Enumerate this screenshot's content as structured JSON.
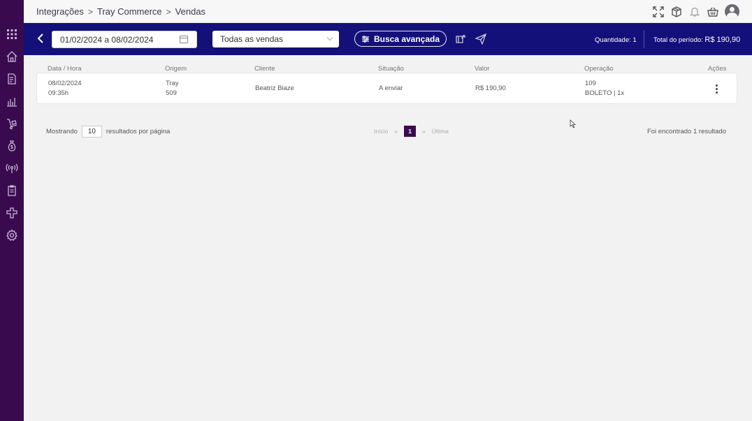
{
  "breadcrumb": {
    "items": [
      "Integrações",
      "Tray Commerce",
      "Vendas"
    ],
    "separator": ">"
  },
  "toolbar": {
    "date_range": "01/02/2024 a 08/02/2024",
    "filter_value": "Todas as vendas",
    "advanced_search_label": "Busca avançada",
    "quantity": "Quantidade: 1",
    "total_label": "Total do período:",
    "total_value": "R$ 190,90"
  },
  "table": {
    "headers": {
      "date": "Data / Hora",
      "origin": "Origem",
      "client": "Cliente",
      "status": "Situação",
      "value": "Valor",
      "operation": "Operação",
      "actions": "Ações"
    },
    "rows": [
      {
        "date": "08/02/2024",
        "time": "09:35h",
        "origin": "Tray",
        "origin_id": "509",
        "client": "Beatriz Biaze",
        "status": "A enviar",
        "value": "R$ 190,90",
        "operation_id": "109",
        "operation_detail": "BOLETO | 1x"
      }
    ]
  },
  "pagination": {
    "showing_label": "Mostrando",
    "per_page": "10",
    "per_page_suffix": "resultados por página",
    "first": "Início",
    "prev": "«",
    "current": "1",
    "next": "»",
    "last": "Última",
    "found": "Foi encontrado 1 resultado"
  },
  "colors": {
    "sidebar": "#3a0a4f",
    "toolbar": "#14107a",
    "accent": "#3a0a4f"
  }
}
